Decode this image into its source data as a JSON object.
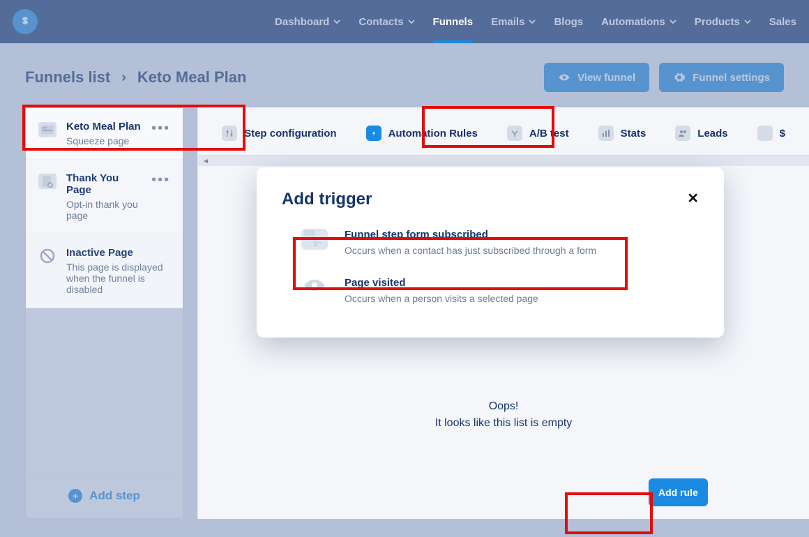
{
  "nav": {
    "items": [
      {
        "label": "Dashboard",
        "dropdown": true
      },
      {
        "label": "Contacts",
        "dropdown": true
      },
      {
        "label": "Funnels",
        "dropdown": false,
        "active": true
      },
      {
        "label": "Emails",
        "dropdown": true
      },
      {
        "label": "Blogs",
        "dropdown": false
      },
      {
        "label": "Automations",
        "dropdown": true
      },
      {
        "label": "Products",
        "dropdown": true
      },
      {
        "label": "Sales",
        "dropdown": false
      }
    ]
  },
  "breadcrumb": {
    "root": "Funnels list",
    "sep": "›",
    "current": "Keto Meal Plan"
  },
  "actions": {
    "view": "View funnel",
    "settings": "Funnel settings"
  },
  "sidebar": {
    "items": [
      {
        "title": "Keto Meal Plan",
        "sub": "Squeeze page"
      },
      {
        "title": "Thank You Page",
        "sub": "Opt-in thank you page"
      },
      {
        "title": "Inactive Page",
        "sub": "This page is displayed when the funnel is disabled"
      }
    ],
    "add": "Add step"
  },
  "tabs": [
    {
      "label": "Step configuration"
    },
    {
      "label": "Automation Rules",
      "active": true
    },
    {
      "label": "A/B test"
    },
    {
      "label": "Stats"
    },
    {
      "label": "Leads"
    },
    {
      "label": "$"
    }
  ],
  "empty": {
    "l1": "Oops!",
    "l2": "It looks like this list is empty"
  },
  "add_rule": "Add rule",
  "modal": {
    "title": "Add trigger",
    "triggers": [
      {
        "title": "Funnel step form subscribed",
        "sub": "Occurs when a contact has just subscribed through a form"
      },
      {
        "title": "Page visited",
        "sub": "Occurs when a person visits a selected page"
      }
    ]
  }
}
